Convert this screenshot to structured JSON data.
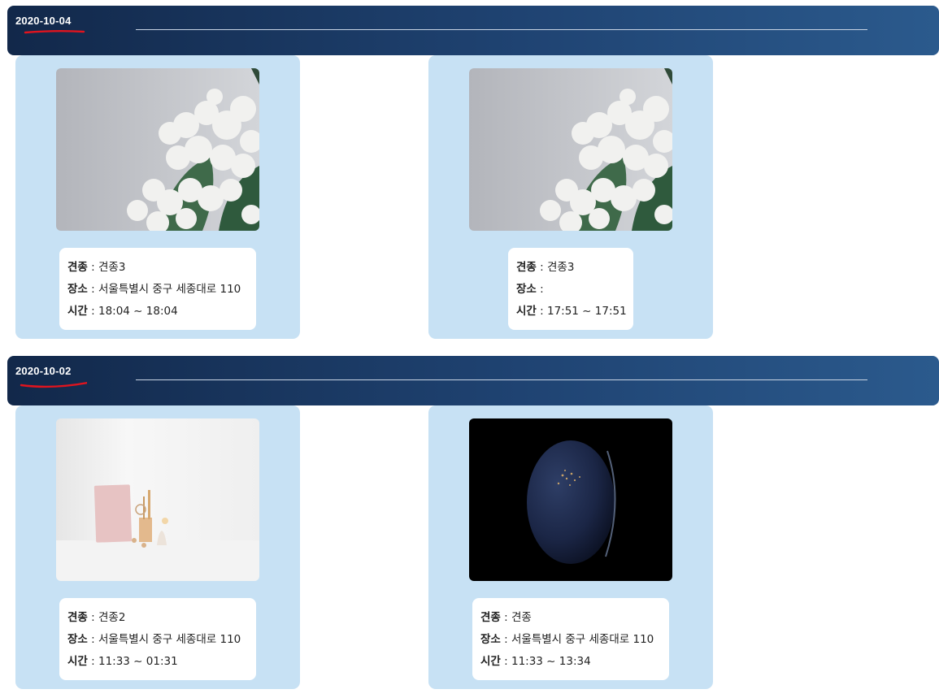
{
  "groups": [
    {
      "date": "2020-10-04",
      "cards": [
        {
          "image": "white-lilac-flowers-photo",
          "breed_label": "견종",
          "breed": "견종3",
          "place_label": "장소",
          "place": "서울특별시 중구 세종대로 110",
          "time_label": "시간",
          "time": "18:04 ~ 18:04"
        },
        {
          "image": "white-lilac-flowers-photo",
          "breed_label": "견종",
          "breed": "견종3",
          "place_label": "장소",
          "place": "",
          "time_label": "시간",
          "time": "17:51 ~ 17:51"
        }
      ]
    },
    {
      "date": "2020-10-02",
      "cards": [
        {
          "image": "desk-book-vase-photo",
          "breed_label": "견종",
          "breed": "견종2",
          "place_label": "장소",
          "place": "서울특별시 중구 세종대로 110",
          "time_label": "시간",
          "time": "11:33 ~ 01:31"
        },
        {
          "image": "earth-at-night-photo",
          "breed_label": "견종",
          "breed": "견종",
          "place_label": "장소",
          "place": "서울특별시 중구 세종대로 110",
          "time_label": "시간",
          "time": "11:33 ~ 13:34"
        }
      ]
    }
  ],
  "separator": " : ",
  "colors": {
    "header_start": "#12284a",
    "header_end": "#2b5a8d",
    "card_bg": "#c7e1f4",
    "date_underline": "#e0141e"
  }
}
